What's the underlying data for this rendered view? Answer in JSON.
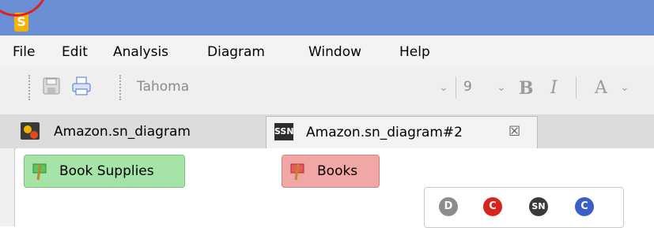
{
  "window": {
    "app_icon": "S"
  },
  "menu": {
    "items": [
      "File",
      "Edit",
      "Analysis",
      "Diagram",
      "Window",
      "Help"
    ]
  },
  "toolbar": {
    "font_family": "Tahoma",
    "font_size": "9",
    "bold_label": "B",
    "italic_label": "I",
    "text_color_label": "A"
  },
  "tabs": [
    {
      "label": "Amazon.sn_diagram",
      "icon": "diagram-icon"
    },
    {
      "label": "Amazon.sn_diagram#2",
      "icon": "ssn-icon",
      "icon_text": "SSN",
      "close": "☒"
    }
  ],
  "nodes": [
    {
      "label": "Book Supplies",
      "color": "#a6e3a6",
      "icon": "flag-icon"
    },
    {
      "label": "Books",
      "color": "#f2a7a7",
      "icon": "flag-icon"
    }
  ],
  "palette": [
    {
      "label": "D",
      "color": "#8c8c8c"
    },
    {
      "label": "C",
      "color": "#d9241c"
    },
    {
      "label": "SN",
      "color": "#3a3a3a"
    },
    {
      "label": "C",
      "color": "#3a5fc8"
    }
  ]
}
